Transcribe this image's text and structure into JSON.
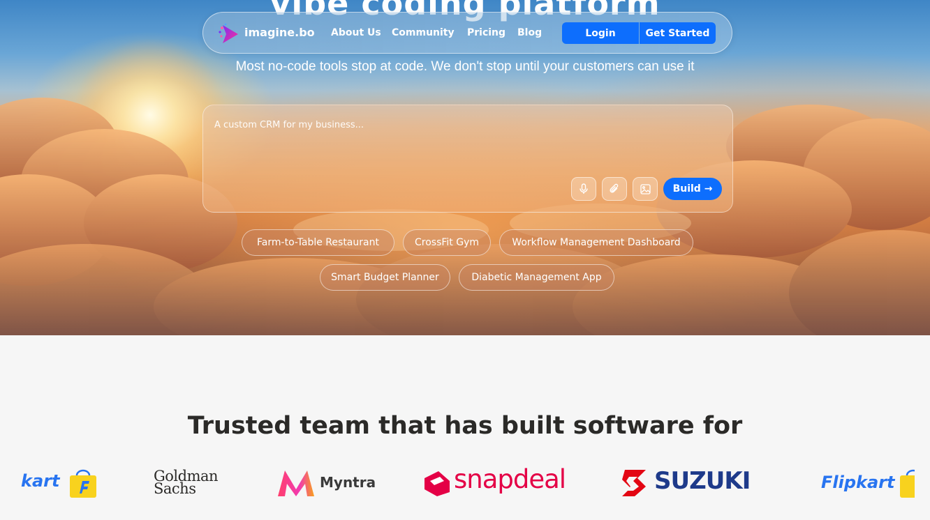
{
  "hero": {
    "title": "vibe coding platform",
    "subtitle": "Most no-code tools stop at code. We don't stop until your customers can use it"
  },
  "nav": {
    "logo_text": "imagine.bo",
    "links": [
      "About Us",
      "Community",
      "Pricing",
      "Blog"
    ],
    "login_label": "Login",
    "get_started_label": "Get Started"
  },
  "prompt": {
    "placeholder": "A custom CRM for my business...",
    "icons": [
      "microphone-icon",
      "paperclip-icon",
      "image-icon"
    ],
    "build_label": "Build →"
  },
  "suggestions": [
    "Farm-to-Table Restaurant",
    "CrossFit Gym",
    "Workflow Management Dashboard",
    "Smart Budget Planner",
    "Diabetic Management App"
  ],
  "trusted": {
    "title": "Trusted team that has built software for",
    "brands": {
      "flipkart_partial": "kart",
      "goldman_line1": "Goldman",
      "goldman_line2": "Sachs",
      "myntra": "Myntra",
      "snapdeal": "snapdeal",
      "suzuki": "SUZUKI",
      "flipkart": "Flipkart"
    }
  },
  "colors": {
    "accent": "#0d6efd",
    "heading": "#2b2a28",
    "section_bg": "#f6f6f6",
    "snapdeal": "#e40046",
    "suzuki_blue": "#1e3a8a",
    "suzuki_red": "#e30613",
    "flipkart_blue": "#2874f0",
    "flipkart_yellow": "#f8d21e"
  }
}
